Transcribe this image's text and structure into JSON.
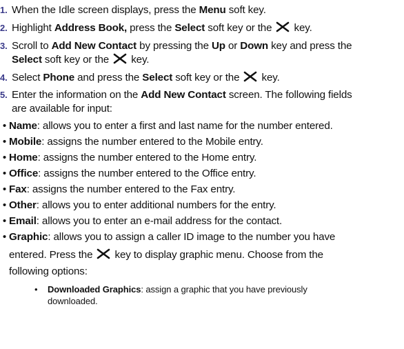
{
  "steps": [
    {
      "num": "1.",
      "a": "When the Idle screen displays, press the ",
      "b1": "Menu",
      "c": " soft key."
    },
    {
      "num": "2.",
      "a": "Highlight ",
      "b1": "Address Book,",
      "c": " press the ",
      "b2": "Select",
      "d": " soft key or the ",
      "e": " key."
    },
    {
      "num": "3.",
      "a": "Scroll to ",
      "b1": "Add New Contact",
      "c": " by pressing the ",
      "b2": "Up",
      "d": " or ",
      "b3": "Down",
      "e": " key and press the",
      "line2_b": "Select",
      "line2_c": " soft key or the ",
      "line2_d": " key."
    },
    {
      "num": "4.",
      "a": "Select ",
      "b1": "Phone",
      "c": " and press the ",
      "b2": "Select",
      "d": " soft key or the ",
      "e": " key."
    },
    {
      "num": "5.",
      "a": "Enter the information on the ",
      "b1": "Add New Contact",
      "c": " screen. The following fields",
      "line2": "are available for input:"
    }
  ],
  "fields": [
    {
      "name": "Name",
      "desc": ": allows you to enter a first and last name for the number entered."
    },
    {
      "name": "Mobile",
      "desc": ": assigns the number entered to the Mobile entry."
    },
    {
      "name": "Home",
      "desc": ": assigns the number entered to the Home entry."
    },
    {
      "name": "Office",
      "desc": ": assigns the number entered to the Office entry."
    },
    {
      "name": "Fax",
      "desc": ": assigns the number entered to the Fax entry."
    },
    {
      "name": "Other",
      "desc": ": allows you to enter additional numbers for the entry."
    },
    {
      "name": "Email",
      "desc": ": allows you to enter an e-mail address for the contact."
    },
    {
      "name": "Graphic",
      "desc": ": allows you to assign a caller ID image to the number you have",
      "line2a": "entered. Press the ",
      "line2b": " key to display graphic menu. Choose from the",
      "line3": "following options:"
    }
  ],
  "graphic_options": [
    {
      "name": "Downloaded Graphics",
      "desc": ": assign a graphic that you have previously",
      "line2": "downloaded."
    }
  ],
  "bullet_char": "•",
  "icons": {
    "select_key": "select-key-icon"
  }
}
